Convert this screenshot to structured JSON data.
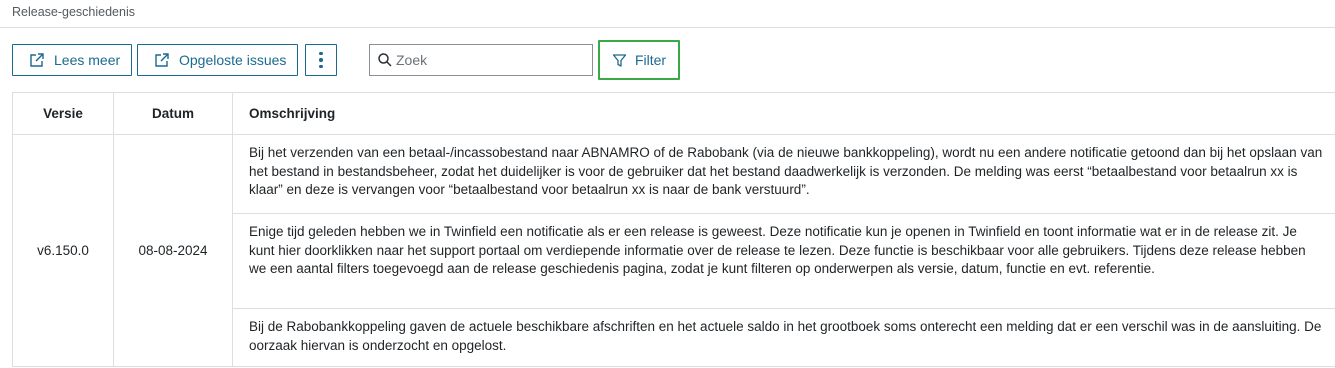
{
  "page": {
    "title": "Release-geschiedenis"
  },
  "toolbar": {
    "lees_meer": "Lees meer",
    "opgeloste_issues": "Opgeloste issues",
    "search_placeholder": "Zoek",
    "filter": "Filter",
    "icons": {
      "external": "external-link-icon",
      "more": "more-vertical-icon",
      "search": "search-icon",
      "filter": "filter-icon"
    }
  },
  "colors": {
    "accent": "#1b6a8f",
    "focus": "#39a845",
    "border": "#dcdfe1"
  },
  "table": {
    "headers": {
      "versie": "Versie",
      "datum": "Datum",
      "omschrijving": "Omschrijving"
    },
    "release": {
      "versie": "v6.150.0",
      "datum": "08-08-2024",
      "items": [
        "Bij het verzenden van een betaal-/incassobestand naar ABNAMRO of de Rabobank (via de nieuwe bankkoppeling), wordt nu een andere notificatie getoond dan bij het opslaan van het bestand in bestandsbeheer, zodat het duidelijker is voor de gebruiker dat het bestand daadwerkelijk is verzonden. De melding was eerst “betaalbestand voor betaalrun xx is klaar” en deze is vervangen voor “betaalbestand voor betaalrun xx is naar de bank verstuurd”.",
        "Enige tijd geleden hebben we in Twinfield een notificatie als er een release is geweest. Deze notificatie kun je openen in Twinfield en toont informatie wat er in de release zit. Je kunt hier doorklikken naar het support portaal om verdiepende informatie over de release te lezen. Deze functie is beschikbaar voor alle gebruikers. Tijdens deze release hebben we een aantal filters toegevoegd aan de release geschiedenis pagina, zodat je kunt filteren op onderwerpen als versie, datum, functie en evt. referentie.",
        "Bij de Rabobankkoppeling gaven de actuele beschikbare afschriften en het actuele saldo in het grootboek soms onterecht een melding dat er een verschil was in de aansluiting. De oorzaak hiervan is onderzocht en opgelost."
      ]
    }
  }
}
